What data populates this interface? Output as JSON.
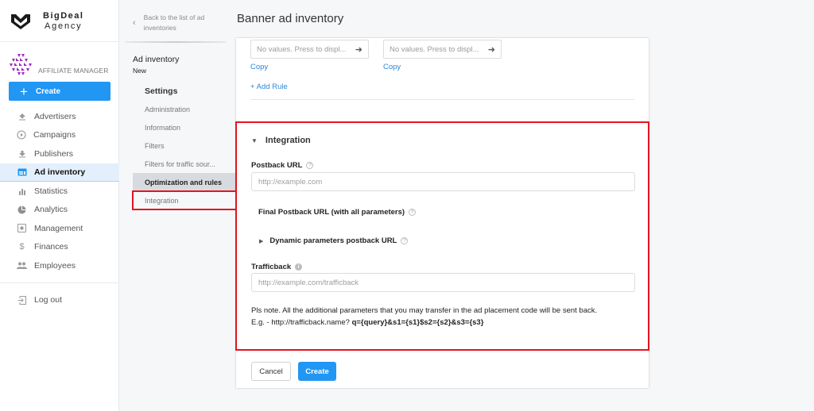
{
  "brand": {
    "line1": "BigDeal",
    "line2": "Agency"
  },
  "role": {
    "label": "AFFILIATE MANAGER"
  },
  "sidebar": {
    "create_label": "Create",
    "items": [
      {
        "label": "Advertisers",
        "icon": "upload-icon"
      },
      {
        "label": "Campaigns",
        "icon": "play-circle-icon"
      },
      {
        "label": "Publishers",
        "icon": "download-icon"
      },
      {
        "label": "Ad inventory",
        "icon": "ad-inventory-icon",
        "active": true
      },
      {
        "label": "Statistics",
        "icon": "bar-chart-icon"
      },
      {
        "label": "Analytics",
        "icon": "pie-chart-icon"
      },
      {
        "label": "Management",
        "icon": "management-icon"
      },
      {
        "label": "Finances",
        "icon": "dollar-icon"
      },
      {
        "label": "Employees",
        "icon": "people-icon"
      }
    ],
    "logout_label": "Log out"
  },
  "subnav": {
    "back_label": "Back to the list of ad inventories",
    "inventory_title": "Ad inventory",
    "inventory_status": "New",
    "settings_heading": "Settings",
    "items": [
      {
        "label": "Administration"
      },
      {
        "label": "Information"
      },
      {
        "label": "Filters"
      },
      {
        "label": "Filters for traffic sour..."
      },
      {
        "label": "Optimization and rules",
        "selected": true
      },
      {
        "label": "Integration",
        "highlighted": true
      }
    ]
  },
  "page": {
    "title": "Banner ad inventory"
  },
  "rules": {
    "selects": [
      {
        "placeholder": "No values. Press to displ...",
        "copy_label": "Copy"
      },
      {
        "placeholder": "No values. Press to displ...",
        "copy_label": "Copy"
      }
    ],
    "add_rule_label": "+ Add Rule"
  },
  "integration": {
    "heading": "Integration",
    "postback_label": "Postback URL",
    "postback_placeholder": "http://example.com",
    "postback_value": "",
    "final_postback_label": "Final Postback URL (with all parameters)",
    "dynamic_params_label": "Dynamic parameters postback URL",
    "trafficback_label": "Trafficback",
    "trafficback_placeholder": "http://example.com/trafficback",
    "trafficback_value": "",
    "note_line1": "Pls note. All the additional parameters that you may transfer in the ad placement code will be sent back.",
    "note_prefix": "E.g. - http://trafficback.name? ",
    "note_example": "q={query}&s1={s1}$s2={s2}&s3={s3}"
  },
  "actions": {
    "cancel_label": "Cancel",
    "create_label": "Create"
  },
  "colors": {
    "accent": "#2196f3",
    "highlight": "#e5141f",
    "link": "#2b87d9",
    "active_bg": "#e3f0fc"
  }
}
